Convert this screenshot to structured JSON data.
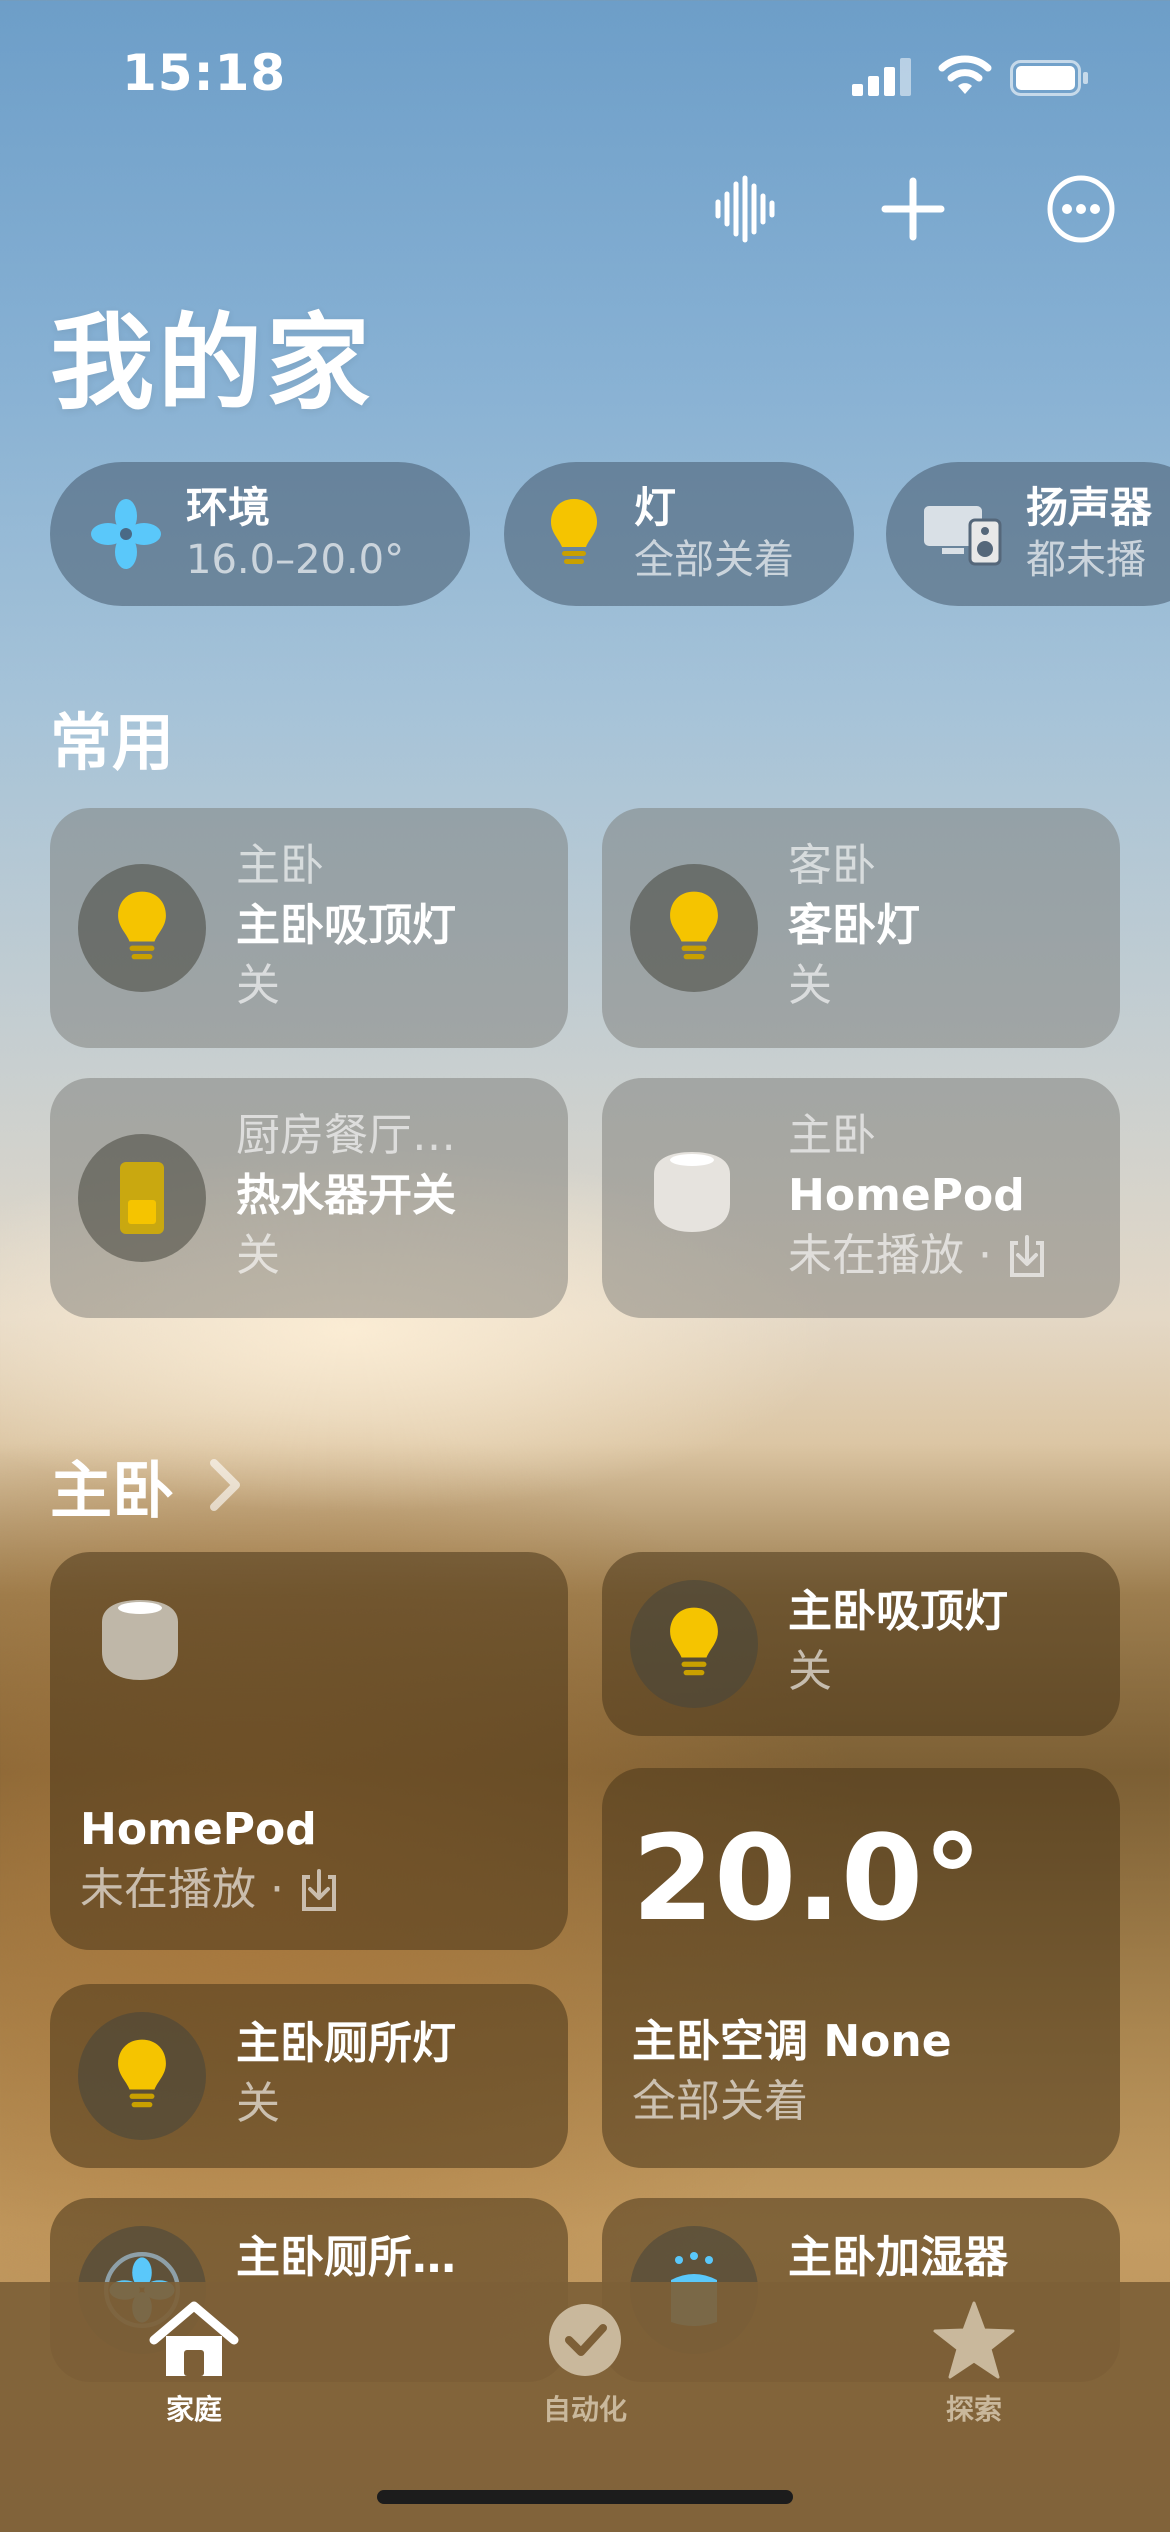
{
  "status": {
    "time": "15:18"
  },
  "header": {
    "title": "我的家",
    "actions": [
      "voice-waveform-icon",
      "plus-icon",
      "more-icon"
    ]
  },
  "summary": [
    {
      "icon": "fan-icon",
      "title": "环境",
      "subtitle": "16.0–20.0°"
    },
    {
      "icon": "lightbulb-icon",
      "title": "灯",
      "subtitle": "全部关着"
    },
    {
      "icon": "speaker-icon",
      "title": "扬声器",
      "subtitle": "都未播"
    }
  ],
  "favorites": {
    "title": "常用",
    "tiles": [
      {
        "room": "主卧",
        "name": "主卧吸顶灯",
        "state": "关",
        "icon": "lightbulb-icon"
      },
      {
        "room": "客卧",
        "name": "客卧灯",
        "state": "关",
        "icon": "lightbulb-icon"
      },
      {
        "room": "厨房餐厅…",
        "name": "热水器开关",
        "state": "关",
        "icon": "switch-icon"
      },
      {
        "room": "主卧",
        "name": "HomePod",
        "state": "未在播放 ·",
        "icon": "homepod-icon"
      }
    ]
  },
  "room": {
    "title": "主卧",
    "homepod": {
      "name": "HomePod",
      "state": "未在播放 ·"
    },
    "ceiling_light": {
      "name": "主卧吸顶灯",
      "state": "关"
    },
    "ac": {
      "temperature": "20.0°",
      "name": "主卧空调 None",
      "state": "全部关着"
    },
    "toilet_light": {
      "name": "主卧厕所灯",
      "state": "关"
    },
    "toilet_fan": {
      "name": "主卧厕所…"
    },
    "humidifier": {
      "name": "主卧加湿器"
    }
  },
  "tabs": [
    {
      "label": "家庭",
      "icon": "home-icon",
      "active": true
    },
    {
      "label": "自动化",
      "icon": "automation-icon",
      "active": false
    },
    {
      "label": "探索",
      "icon": "star-icon",
      "active": false
    }
  ],
  "colors": {
    "bulb": "#f5c400",
    "tab_active": "#ffffff",
    "tab_inactive": "#c9b89c"
  }
}
